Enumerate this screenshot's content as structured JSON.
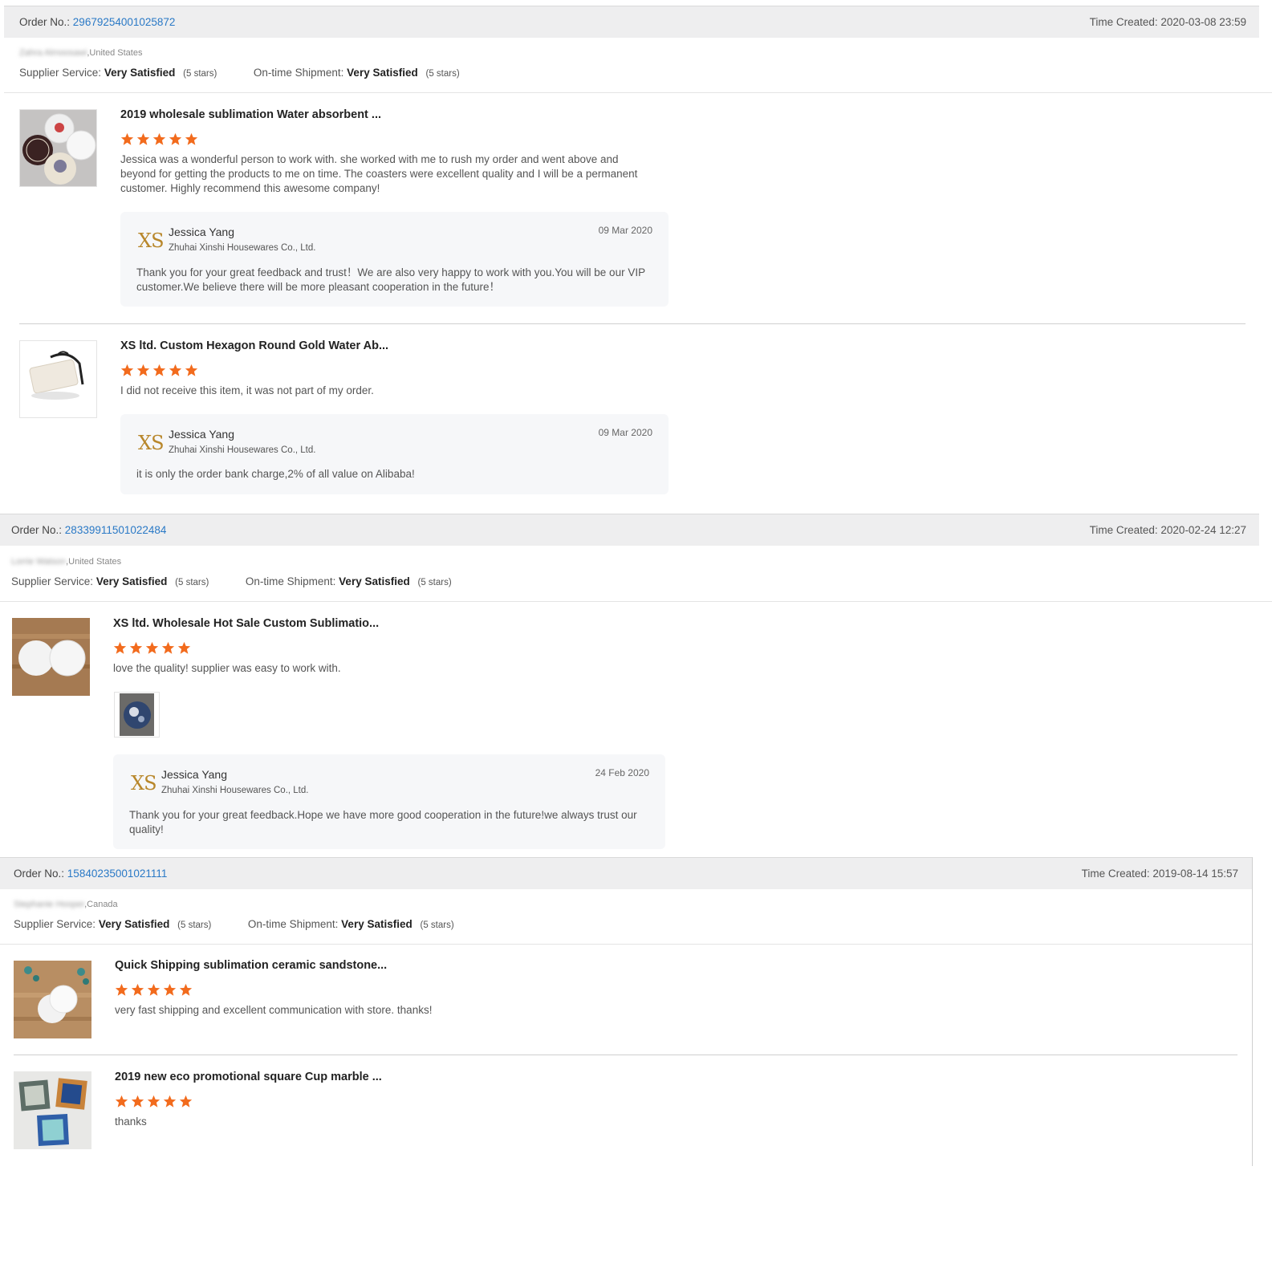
{
  "colors": {
    "header_bg": "#eeeeef",
    "order_link": "#2a79c6",
    "star": "#f26b1d",
    "reply_bg": "#f6f7f9",
    "logo": "#b8872b"
  },
  "labels": {
    "order_no": "Order No.:",
    "time_created": "Time Created:",
    "supplier_service": "Supplier Service:",
    "ontime_shipment": "On-time Shipment:"
  },
  "orders": [
    {
      "order_no": "29679254001025872",
      "time_created": "2020-03-08 23:59",
      "buyer_name": "Zahra Almoosawi",
      "buyer_country": ",United States",
      "supplier_service_value": "Very Satisfied",
      "supplier_service_stars": "(5 stars)",
      "shipment_value": "Very Satisfied",
      "shipment_stars": "(5 stars)",
      "reviews": [
        {
          "title": "2019 wholesale sublimation Water absorbent ...",
          "rating": 5,
          "thumb_icon": "coaster-set-image",
          "comment": "Jessica was a wonderful person to work with. she worked with me to rush my order and went above and beyond for getting the products to me on time. The coasters were excellent quality and I will be a permanent customer. Highly recommend this awesome company!",
          "reply": {
            "logo": "XS",
            "name": "Jessica Yang",
            "company": "Zhuhai Xinshi Housewares Co., Ltd.",
            "date": "09 Mar 2020",
            "text": "Thank you for your great feedback and trust！We are also very happy to work with you.You will be our VIP customer.We believe there will be more pleasant cooperation in the future！"
          }
        },
        {
          "title": "XS ltd. Custom Hexagon Round Gold Water Ab...",
          "rating": 5,
          "thumb_icon": "coaster-holder-image",
          "comment": "I did not receive this item, it was not part of my order.",
          "reply": {
            "logo": "XS",
            "name": "Jessica Yang",
            "company": "Zhuhai Xinshi Housewares Co., Ltd.",
            "date": "09 Mar 2020",
            "text": "it is only the order bank charge,2% of all value on Alibaba!"
          }
        }
      ]
    },
    {
      "order_no": "28339911501022484",
      "time_created": "2020-02-24 12:27",
      "buyer_name": "Lorrie Watson",
      "buyer_country": ",United States",
      "supplier_service_value": "Very Satisfied",
      "supplier_service_stars": "(5 stars)",
      "shipment_value": "Very Satisfied",
      "shipment_stars": "(5 stars)",
      "reviews": [
        {
          "title": "XS ltd. Wholesale Hot Sale Custom Sublimatio...",
          "rating": 5,
          "thumb_icon": "round-coasters-image",
          "comment": "love the quality! supplier was easy to work with.",
          "attachment_icon": "coaster-photo-attachment",
          "reply": {
            "logo": "XS",
            "name": "Jessica Yang",
            "company": "Zhuhai Xinshi Housewares Co., Ltd.",
            "date": "24 Feb 2020",
            "text": "Thank you for your great feedback.Hope we have more good cooperation in the future!we always trust our quality!"
          }
        }
      ]
    },
    {
      "order_no": "15840235001021111",
      "time_created": "2019-08-14 15:57",
      "buyer_name": "Stephanie Hooper",
      "buyer_country": ",Canada",
      "supplier_service_value": "Very Satisfied",
      "supplier_service_stars": "(5 stars)",
      "shipment_value": "Very Satisfied",
      "shipment_stars": "(5 stars)",
      "reviews": [
        {
          "title": "Quick Shipping sublimation ceramic sandstone...",
          "rating": 5,
          "thumb_icon": "sandstone-coasters-image",
          "comment": "very fast shipping and excellent communication with store. thanks!"
        },
        {
          "title": "2019 new eco promotional square Cup marble ...",
          "rating": 5,
          "thumb_icon": "square-tile-coasters-image",
          "comment": "thanks"
        }
      ]
    }
  ]
}
